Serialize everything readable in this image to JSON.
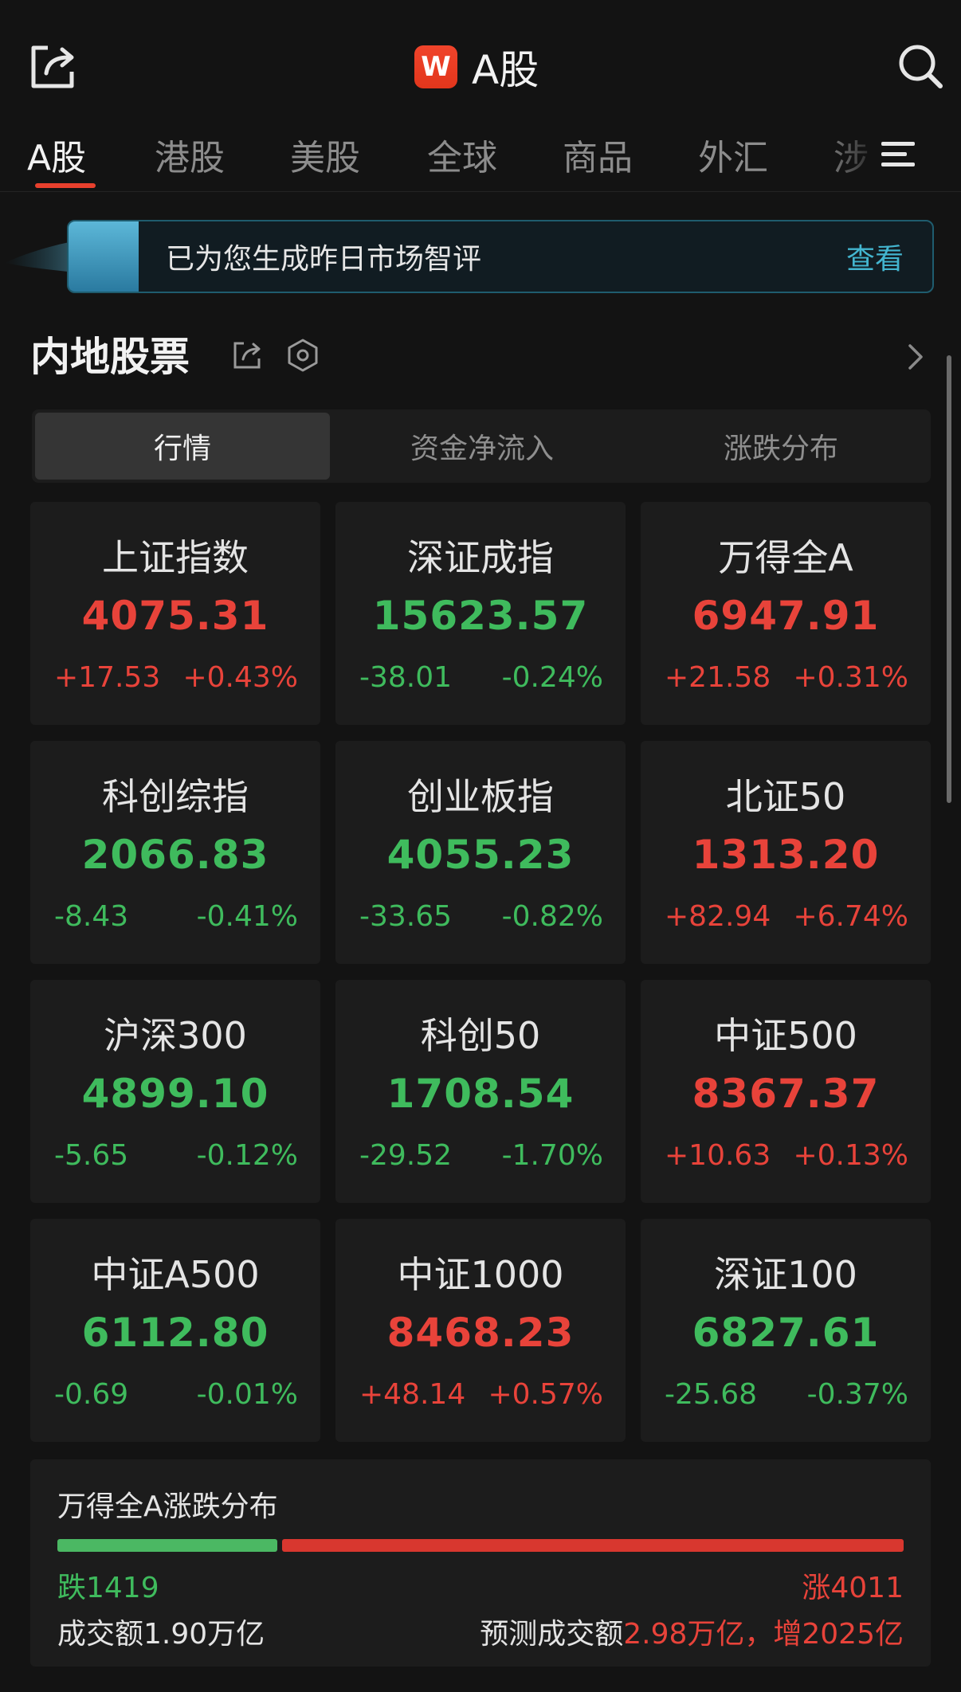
{
  "header": {
    "logo_letter": "W",
    "title": "A股",
    "icons": {
      "left": "share-icon",
      "right": "search-icon"
    }
  },
  "tabs": [
    {
      "label": "A股",
      "active": true
    },
    {
      "label": "港股"
    },
    {
      "label": "美股"
    },
    {
      "label": "全球"
    },
    {
      "label": "商品"
    },
    {
      "label": "外汇"
    },
    {
      "label": "涉"
    }
  ],
  "banner": {
    "text": "已为您生成昨日市场智评",
    "link": "查看"
  },
  "section": {
    "title": "内地股票"
  },
  "segments": [
    {
      "label": "行情",
      "active": true
    },
    {
      "label": "资金净流入"
    },
    {
      "label": "涨跌分布"
    }
  ],
  "colors": {
    "up": "#e8433a",
    "down": "#3fbb5d",
    "accent": "#e8402d",
    "link": "#43b5cf"
  },
  "indices": [
    {
      "name": "上证指数",
      "value": "4075.31",
      "change": "+17.53",
      "pct": "+0.43%",
      "dir": "up"
    },
    {
      "name": "深证成指",
      "value": "15623.57",
      "change": "-38.01",
      "pct": "-0.24%",
      "dir": "down"
    },
    {
      "name": "万得全A",
      "value": "6947.91",
      "change": "+21.58",
      "pct": "+0.31%",
      "dir": "up"
    },
    {
      "name": "科创综指",
      "value": "2066.83",
      "change": "-8.43",
      "pct": "-0.41%",
      "dir": "down"
    },
    {
      "name": "创业板指",
      "value": "4055.23",
      "change": "-33.65",
      "pct": "-0.82%",
      "dir": "down"
    },
    {
      "name": "北证50",
      "value": "1313.20",
      "change": "+82.94",
      "pct": "+6.74%",
      "dir": "up"
    },
    {
      "name": "沪深300",
      "value": "4899.10",
      "change": "-5.65",
      "pct": "-0.12%",
      "dir": "down"
    },
    {
      "name": "科创50",
      "value": "1708.54",
      "change": "-29.52",
      "pct": "-1.70%",
      "dir": "down"
    },
    {
      "name": "中证500",
      "value": "8367.37",
      "change": "+10.63",
      "pct": "+0.13%",
      "dir": "up"
    },
    {
      "name": "中证A500",
      "value": "6112.80",
      "change": "-0.69",
      "pct": "-0.01%",
      "dir": "down"
    },
    {
      "name": "中证1000",
      "value": "8468.23",
      "change": "+48.14",
      "pct": "+0.57%",
      "dir": "up"
    },
    {
      "name": "深证100",
      "value": "6827.61",
      "change": "-25.68",
      "pct": "-0.37%",
      "dir": "down"
    }
  ],
  "breadth": {
    "title": "万得全A涨跌分布",
    "fall_label": "跌1419",
    "rise_label": "涨4011",
    "fall_count": 1419,
    "rise_count": 4011,
    "turnover": "成交额1.90万亿",
    "forecast_prefix": "预测成交额",
    "forecast_value": "2.98万亿，增2025亿"
  }
}
